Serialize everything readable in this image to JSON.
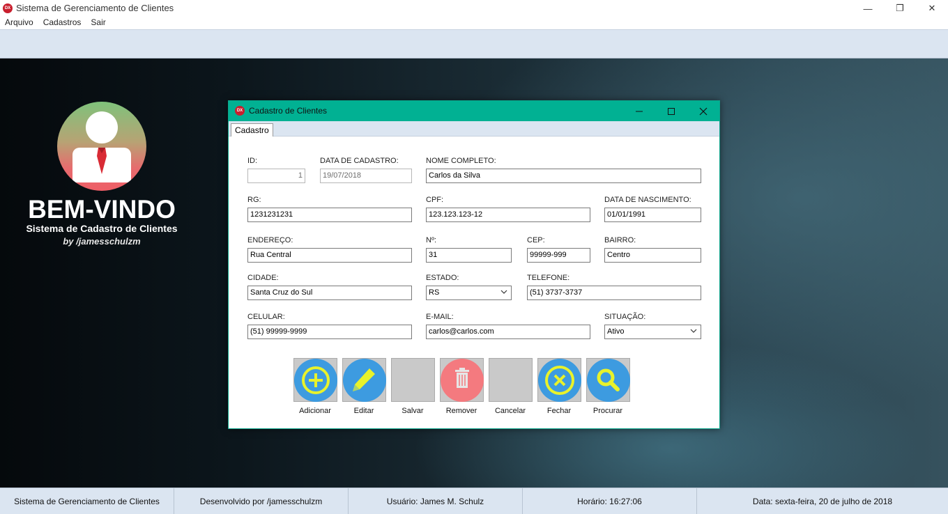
{
  "app": {
    "title": "Sistema de Gerenciamento de Clientes",
    "icon_text": "DX",
    "controls": {
      "minimize": "—",
      "maximize": "❐",
      "close": "✕"
    }
  },
  "menu": [
    "Arquivo",
    "Cadastros",
    "Sair"
  ],
  "welcome": {
    "title": "BEM-VINDO",
    "subtitle": "Sistema de Cadastro de Clientes",
    "byline": "by /jamesschulzm"
  },
  "child_window": {
    "title": "Cadastro de Clientes",
    "icon_text": "DX",
    "tab": "Cadastro",
    "accent_color": "#01b193"
  },
  "form": {
    "id": {
      "label": "ID:",
      "value": "1"
    },
    "data_cadastro": {
      "label": "DATA DE CADASTRO:",
      "value": "19/07/2018"
    },
    "nome": {
      "label": "NOME COMPLETO:",
      "value": "Carlos da Silva"
    },
    "rg": {
      "label": "RG:",
      "value": "1231231231"
    },
    "cpf": {
      "label": "CPF:",
      "value": "123.123.123-12"
    },
    "nascimento": {
      "label": "DATA DE NASCIMENTO:",
      "value": "01/01/1991"
    },
    "endereco": {
      "label": "ENDEREÇO:",
      "value": "Rua Central"
    },
    "numero": {
      "label": "Nº:",
      "value": "31"
    },
    "cep": {
      "label": "CEP:",
      "value": "99999-999"
    },
    "bairro": {
      "label": "BAIRRO:",
      "value": "Centro"
    },
    "cidade": {
      "label": "CIDADE:",
      "value": "Santa Cruz do Sul"
    },
    "estado": {
      "label": "ESTADO:",
      "value": "RS"
    },
    "telefone": {
      "label": "TELEFONE:",
      "value": "(51) 3737-3737"
    },
    "celular": {
      "label": "CELULAR:",
      "value": "(51) 99999-9999"
    },
    "email": {
      "label": "E-MAIL:",
      "value": "carlos@carlos.com"
    },
    "situacao": {
      "label": "SITUAÇÃO:",
      "value": "Ativo"
    }
  },
  "buttons": {
    "adicionar": "Adicionar",
    "editar": "Editar",
    "salvar": "Salvar",
    "remover": "Remover",
    "cancelar": "Cancelar",
    "fechar": "Fechar",
    "procurar": "Procurar"
  },
  "colors": {
    "button_blue": "#3d9be0",
    "button_yellow": "#e8f22b",
    "button_red": "#f47a7f",
    "button_disabled": "#c9c9c9"
  },
  "statusbar": [
    "Sistema de Gerenciamento de Clientes",
    "Desenvolvido por /jamesschulzm",
    "Usuário: James M. Schulz",
    "Horário: 16:27:06",
    "Data: sexta-feira, 20 de julho de 2018"
  ]
}
